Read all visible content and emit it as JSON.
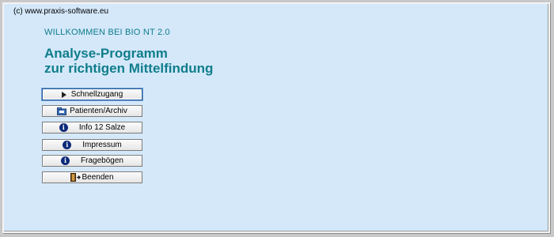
{
  "header": {
    "copyright": "(c) www.praxis-software.eu",
    "welcome": "WILLKOMMEN BEI BIO NT 2.0",
    "title_line1": "Analyse-Programm",
    "title_line2": "zur richtigen Mittelfindung"
  },
  "buttons": {
    "schnellzugang": "Schnellzugang",
    "patienten": "Patienten/Archiv",
    "info_salze": "Info 12 Salze",
    "impressum": "Impressum",
    "frageboegen": "Fragebögen",
    "beenden": "Beenden"
  },
  "icons": {
    "schnellzugang": "play-icon",
    "patienten": "folder-icon",
    "info": "info-icon",
    "beenden": "exit-door-icon"
  },
  "colors": {
    "accent_text": "#0f7d8b",
    "background": "#d4e8fa",
    "info_icon": "#0c2a7a"
  }
}
